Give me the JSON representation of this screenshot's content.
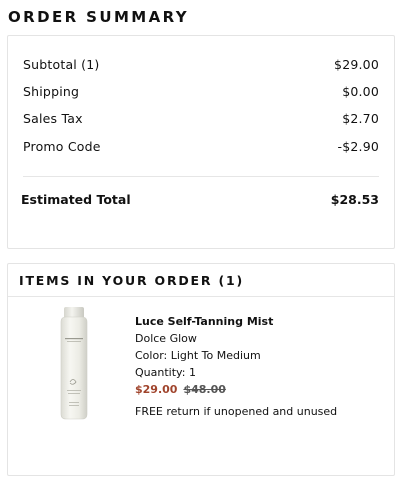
{
  "order_summary": {
    "title": "ORDER SUMMARY",
    "rows": [
      {
        "label": "Subtotal (1)",
        "value": "$29.00"
      },
      {
        "label": "Shipping",
        "value": "$0.00"
      },
      {
        "label": "Sales Tax",
        "value": "$2.70"
      },
      {
        "label": "Promo Code",
        "value": "-$2.90"
      }
    ],
    "total": {
      "label": "Estimated Total",
      "value": "$28.53"
    }
  },
  "items": {
    "title": "ITEMS IN YOUR ORDER (1)",
    "products": [
      {
        "name": "Luce Self-Tanning Mist",
        "brand": "Dolce Glow",
        "color_label": "Color:",
        "color_value": "Light To Medium",
        "quantity_label": "Quantity:",
        "quantity_value": "1",
        "sale_price": "$29.00",
        "original_price": "$48.00",
        "return_note": "FREE return if unopened and unused",
        "image_icon": "spray-bottle-product-image"
      }
    ]
  },
  "colors": {
    "sale_price": "#a0442c",
    "border": "#e4e4e4",
    "text": "#111111"
  }
}
